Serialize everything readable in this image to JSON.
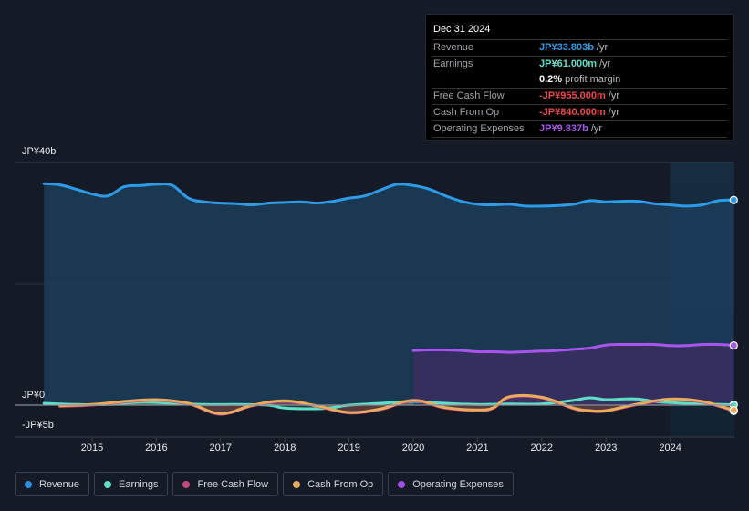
{
  "tooltip": {
    "date": "Dec 31 2024",
    "rows": [
      {
        "label": "Revenue",
        "value": "JP¥33.803b",
        "unit": "/yr",
        "color": "#2e9be8"
      },
      {
        "label": "Earnings",
        "value": "JP¥61.000m",
        "unit": "/yr",
        "color": "#5ee0c8"
      },
      {
        "label": "",
        "value": "0.2%",
        "unit": "profit margin",
        "color": "#ffffff"
      },
      {
        "label": "Free Cash Flow",
        "value": "-JP¥955.000m",
        "unit": "/yr",
        "color": "#e84848"
      },
      {
        "label": "Cash From Op",
        "value": "-JP¥840.000m",
        "unit": "/yr",
        "color": "#e84848"
      },
      {
        "label": "Operating Expenses",
        "value": "JP¥9.837b",
        "unit": "/yr",
        "color": "#a855f0"
      }
    ]
  },
  "legend": [
    {
      "label": "Revenue",
      "color": "#2e8fe0"
    },
    {
      "label": "Earnings",
      "color": "#5ee0c8"
    },
    {
      "label": "Free Cash Flow",
      "color": "#c8467e"
    },
    {
      "label": "Cash From Op",
      "color": "#e8ac5c"
    },
    {
      "label": "Operating Expenses",
      "color": "#a04ee8"
    }
  ],
  "chart_data": {
    "type": "area",
    "title": "",
    "xlabel": "",
    "ylabel": "",
    "y_tick_labels": [
      "JP¥40b",
      "JP¥0",
      "-JP¥5b"
    ],
    "x_tick_labels": [
      "2015",
      "2016",
      "2017",
      "2018",
      "2019",
      "2020",
      "2021",
      "2022",
      "2023",
      "2024"
    ],
    "x_ticks": [
      2015,
      2016,
      2017,
      2018,
      2019,
      2020,
      2021,
      2022,
      2023,
      2024
    ],
    "ylim": [
      -5,
      40
    ],
    "xlim": [
      2014.0,
      2025.0
    ],
    "grid": true,
    "highlight_start": 2024.0,
    "series": [
      {
        "name": "Revenue",
        "unit": "JP¥b",
        "color": "#2e9be8",
        "fill": "#1b3d5a",
        "x": [
          2014.25,
          2014.5,
          2014.75,
          2015.0,
          2015.25,
          2015.5,
          2015.75,
          2016.0,
          2016.25,
          2016.5,
          2016.75,
          2017.0,
          2017.25,
          2017.5,
          2017.75,
          2018.0,
          2018.25,
          2018.5,
          2018.75,
          2019.0,
          2019.25,
          2019.5,
          2019.75,
          2020.0,
          2020.25,
          2020.5,
          2020.75,
          2021.0,
          2021.25,
          2021.5,
          2021.75,
          2022.0,
          2022.25,
          2022.5,
          2022.75,
          2023.0,
          2023.25,
          2023.5,
          2023.75,
          2024.0,
          2024.25,
          2024.5,
          2024.75,
          2024.99
        ],
        "values": [
          36.5,
          36.3,
          35.6,
          34.8,
          34.5,
          36.0,
          36.2,
          36.4,
          36.2,
          34.1,
          33.5,
          33.3,
          33.2,
          33.0,
          33.3,
          33.4,
          33.5,
          33.3,
          33.6,
          34.1,
          34.5,
          35.5,
          36.4,
          36.2,
          35.6,
          34.5,
          33.6,
          33.1,
          33.0,
          33.1,
          32.8,
          32.8,
          32.9,
          33.1,
          33.7,
          33.5,
          33.6,
          33.6,
          33.2,
          33.0,
          32.8,
          33.0,
          33.7,
          33.8
        ]
      },
      {
        "name": "Earnings",
        "unit": "JP¥b",
        "color": "#5ee0c8",
        "x": [
          2014.25,
          2014.75,
          2015.25,
          2015.75,
          2016.25,
          2016.75,
          2017.25,
          2017.75,
          2018.0,
          2018.5,
          2018.75,
          2019.0,
          2019.5,
          2020.0,
          2020.5,
          2021.0,
          2021.5,
          2022.0,
          2022.5,
          2022.75,
          2023.0,
          2023.25,
          2023.5,
          2023.75,
          2024.0,
          2024.5,
          2024.99
        ],
        "values": [
          0.3,
          0.1,
          0.1,
          0.5,
          0.3,
          0.1,
          0.1,
          0.0,
          -0.5,
          -0.6,
          -0.4,
          0.0,
          0.3,
          0.6,
          0.3,
          0.1,
          0.2,
          0.2,
          0.8,
          1.2,
          0.9,
          1.0,
          1.0,
          0.6,
          0.4,
          0.2,
          0.06
        ]
      },
      {
        "name": "Free Cash Flow",
        "unit": "JP¥b",
        "color": "#c8467e",
        "x": [
          2014.5,
          2015.0,
          2015.5,
          2016.0,
          2016.5,
          2017.0,
          2017.5,
          2018.0,
          2018.5,
          2019.0,
          2019.5,
          2020.0,
          2020.5,
          2021.0,
          2021.25,
          2021.5,
          2022.0,
          2022.5,
          2022.75,
          2023.0,
          2023.5,
          2024.0,
          2024.5,
          2024.99
        ],
        "values": [
          -0.2,
          0.0,
          0.5,
          0.8,
          0.2,
          -1.5,
          -0.1,
          0.6,
          -0.2,
          -1.3,
          -0.7,
          0.7,
          -0.5,
          -0.9,
          -0.5,
          1.3,
          1.2,
          -0.6,
          -1.0,
          -1.0,
          0.1,
          0.9,
          0.5,
          -0.96
        ]
      },
      {
        "name": "Cash From Op",
        "unit": "JP¥b",
        "color": "#e8ac5c",
        "x": [
          2014.5,
          2015.0,
          2015.5,
          2016.0,
          2016.5,
          2017.0,
          2017.5,
          2018.0,
          2018.5,
          2019.0,
          2019.5,
          2020.0,
          2020.5,
          2021.0,
          2021.25,
          2021.5,
          2022.0,
          2022.5,
          2022.75,
          2023.0,
          2023.5,
          2024.0,
          2024.5,
          2024.99
        ],
        "values": [
          -0.1,
          0.1,
          0.6,
          0.9,
          0.3,
          -1.4,
          0.0,
          0.7,
          -0.1,
          -1.2,
          -0.6,
          0.8,
          -0.4,
          -0.8,
          -0.4,
          1.4,
          1.3,
          -0.5,
          -0.9,
          -0.9,
          0.2,
          1.0,
          0.6,
          -0.84
        ]
      },
      {
        "name": "Operating Expenses",
        "unit": "JP¥b",
        "color": "#a855f0",
        "fill": "#3a2e62",
        "x": [
          2020.0,
          2020.25,
          2020.5,
          2020.75,
          2021.0,
          2021.25,
          2021.5,
          2021.75,
          2022.0,
          2022.25,
          2022.5,
          2022.75,
          2023.0,
          2023.25,
          2023.5,
          2023.75,
          2024.0,
          2024.25,
          2024.5,
          2024.75,
          2024.99
        ],
        "values": [
          9.0,
          9.1,
          9.1,
          9.0,
          8.8,
          8.8,
          8.7,
          8.8,
          8.9,
          9.0,
          9.2,
          9.4,
          9.9,
          10.0,
          10.0,
          10.0,
          9.8,
          9.8,
          10.0,
          10.0,
          9.84
        ]
      }
    ]
  }
}
